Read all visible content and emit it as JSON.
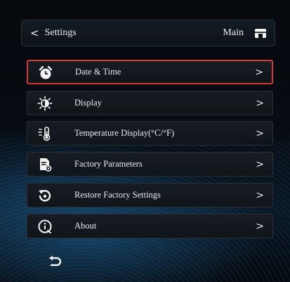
{
  "header": {
    "back_symbol": "<",
    "title": "Settings",
    "main_label": "Main"
  },
  "menu": {
    "items": [
      {
        "label": "Date & Time",
        "icon": "alarm-clock-icon",
        "selected": true
      },
      {
        "label": "Display",
        "icon": "brightness-icon",
        "selected": false
      },
      {
        "label": "Temperature Display(°C/°F)",
        "icon": "thermometer-icon",
        "selected": false
      },
      {
        "label": "Factory Parameters",
        "icon": "document-settings-icon",
        "selected": false
      },
      {
        "label": "Restore Factory Settings",
        "icon": "restore-icon",
        "selected": false
      },
      {
        "label": "About",
        "icon": "info-icon",
        "selected": false
      }
    ],
    "chevron": ">"
  },
  "colors": {
    "selection_border": "#d33a34",
    "text": "#e6ebf0"
  }
}
